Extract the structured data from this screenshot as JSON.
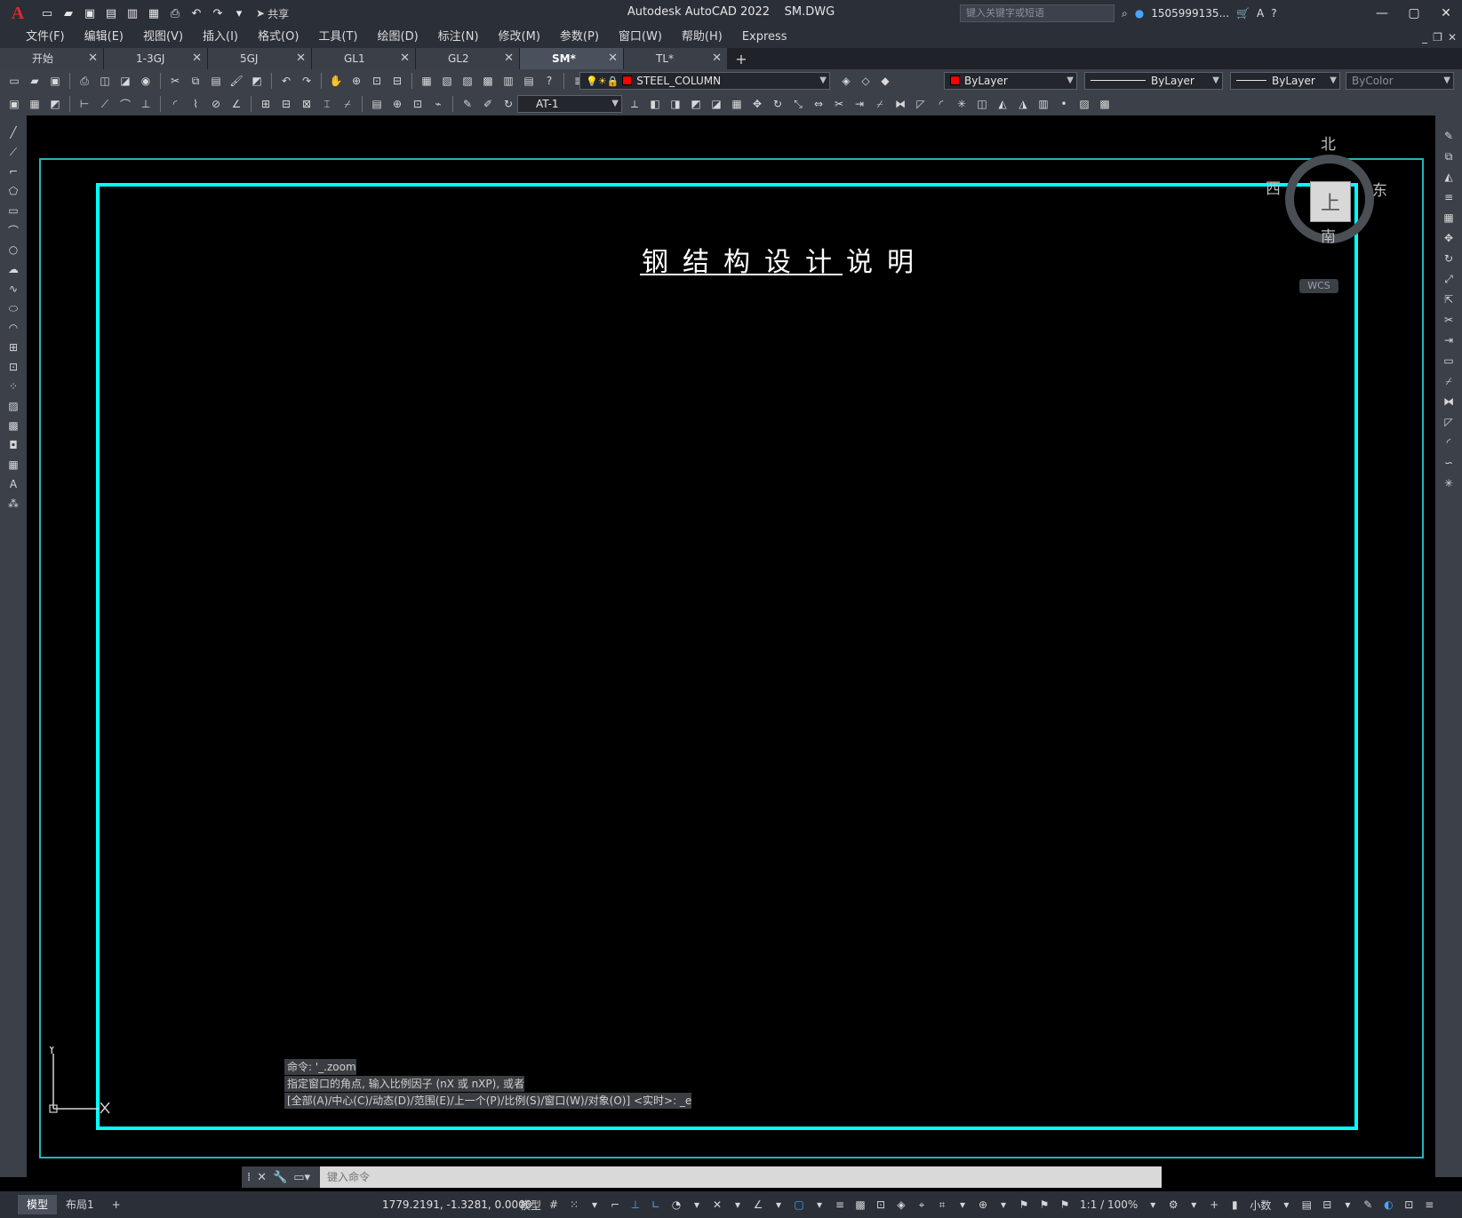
{
  "window": {
    "app_title": "Autodesk AutoCAD 2022",
    "file_name": "SM.DWG",
    "search_placeholder": "键入关键字或短语",
    "user_name": "1505999135...",
    "share_label": "共享"
  },
  "menu": [
    "文件(F)",
    "编辑(E)",
    "视图(V)",
    "插入(I)",
    "格式(O)",
    "工具(T)",
    "绘图(D)",
    "标注(N)",
    "修改(M)",
    "参数(P)",
    "窗口(W)",
    "帮助(H)",
    "Express"
  ],
  "tabs": [
    {
      "label": "开始",
      "active": false
    },
    {
      "label": "1-3GJ",
      "active": false
    },
    {
      "label": "5GJ",
      "active": false
    },
    {
      "label": "GL1",
      "active": false
    },
    {
      "label": "GL2",
      "active": false
    },
    {
      "label": "SM*",
      "active": true
    },
    {
      "label": "TL*",
      "active": false
    }
  ],
  "layer_combo": {
    "value": "STEEL_COLUMN"
  },
  "color_combo": {
    "value": "ByLayer",
    "swatch": "#ff0000"
  },
  "linetype_combo": {
    "value": "ByLayer"
  },
  "lineweight_combo": {
    "value": "ByLayer"
  },
  "plotstyle_combo": {
    "value": "ByColor"
  },
  "textstyle_combo": {
    "value": "AT-1"
  },
  "drawing": {
    "title": "钢结构设计说明",
    "frame_color": "#00ffff"
  },
  "viewcube": {
    "north": "北",
    "south": "南",
    "east": "东",
    "west": "西",
    "face": "上",
    "wcs": "WCS"
  },
  "ucs": {
    "y_label": "Y"
  },
  "command": {
    "history": [
      "命令: '_.zoom",
      "指定窗口的角点, 输入比例因子 (nX 或 nXP), 或者",
      "[全部(A)/中心(C)/动态(D)/范围(E)/上一个(P)/比例(S)/窗口(W)/对象(O)] <实时>: _e"
    ],
    "input_placeholder": "键入命令"
  },
  "status": {
    "layout_tabs": [
      "模型",
      "布局1"
    ],
    "coords": "1779.2191, -1.3281, 0.0000",
    "model_label": "模型",
    "scale": "1:1 / 100%",
    "units": "小数"
  }
}
